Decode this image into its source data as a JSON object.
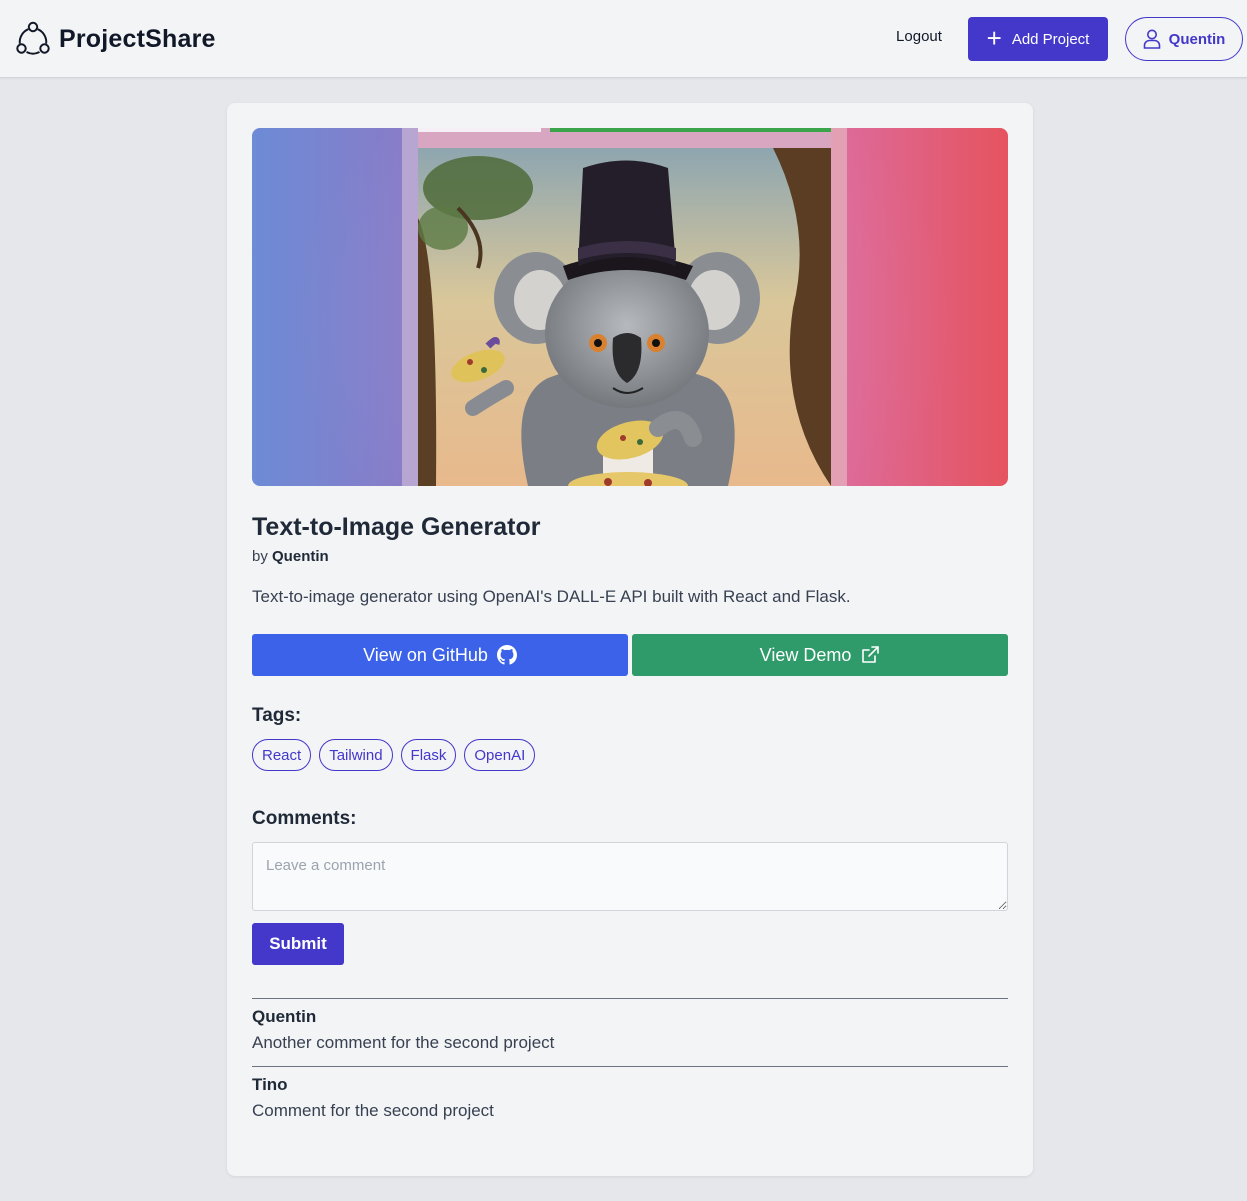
{
  "header": {
    "brand": "ProjectShare",
    "logout_label": "Logout",
    "add_project_label": "Add Project",
    "user_label": "Quentin"
  },
  "project": {
    "title": "Text-to-Image Generator",
    "by_prefix": "by",
    "author": "Quentin",
    "description": "Text-to-image generator using OpenAI's DALL-E API built with React and Flask.",
    "github_label": "View on GitHub",
    "demo_label": "View Demo"
  },
  "tags": {
    "label": "Tags:",
    "items": [
      "React",
      "Tailwind",
      "Flask",
      "OpenAI"
    ]
  },
  "comments": {
    "label": "Comments:",
    "placeholder": "Leave a comment",
    "submit_label": "Submit",
    "items": [
      {
        "author": "Quentin",
        "text": "Another comment for the second project"
      },
      {
        "author": "Tino",
        "text": "Comment for the second project"
      }
    ]
  },
  "icons": {
    "logo": "share-nodes-icon",
    "add": "plus-icon",
    "user": "user-icon",
    "github": "github-icon",
    "demo": "external-link-icon"
  },
  "colors": {
    "accent": "#4338ca",
    "github_button": "#3b62e8",
    "demo_button": "#2f9a6a",
    "background": "#e5e7eb",
    "card": "#f3f4f6"
  }
}
